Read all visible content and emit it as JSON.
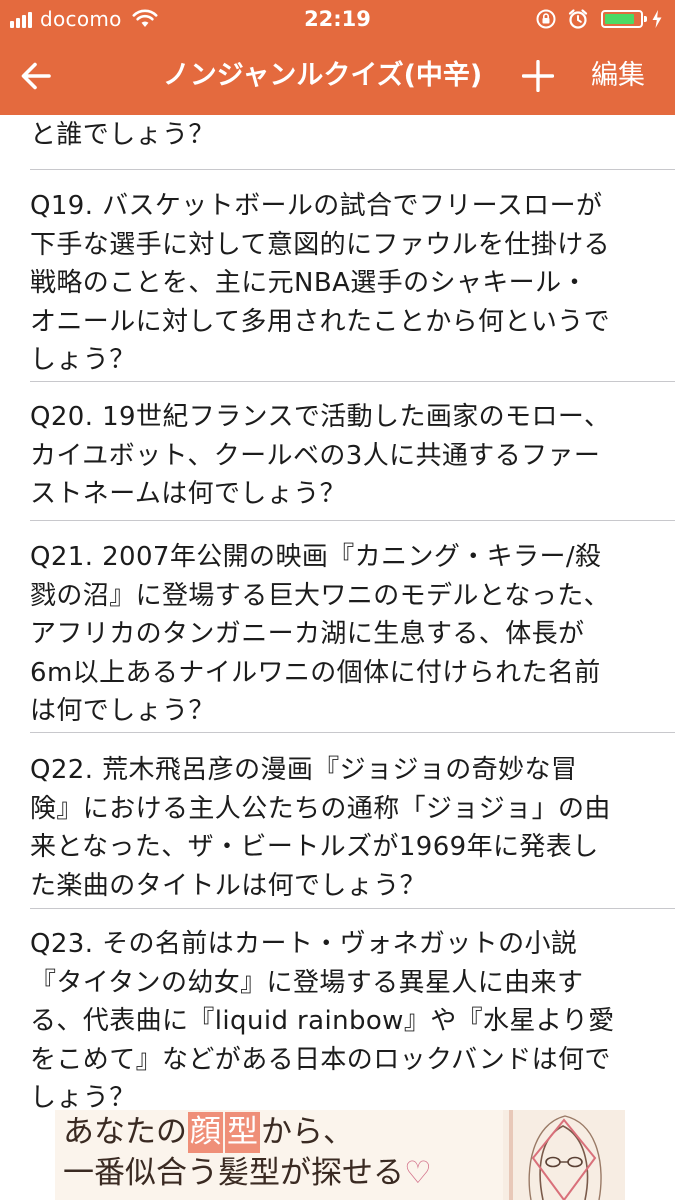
{
  "status_bar": {
    "carrier": "docomo",
    "time": "22:19"
  },
  "nav": {
    "title": "ノンジャンルクイズ(中辛)",
    "edit_label": "編集"
  },
  "colors": {
    "header_bg": "#e46a3e",
    "battery": "#4cd964"
  },
  "battery_level": 0.85,
  "questions": [
    {
      "lines": [
        "と誰でしょう？"
      ]
    },
    {
      "lines": [
        "Q19. バスケットボールの試合でフリースローが",
        "下手な選手に対して意図的にファウルを仕掛ける",
        "戦略のことを、主に元NBA選手のシャキール・",
        "オニールに対して多用されたことから何というで",
        "しょう？"
      ]
    },
    {
      "lines": [
        "Q20. 19世紀フランスで活動した画家のモロー、",
        "カイユボット、クールベの3人に共通するファー",
        "ストネームは何でしょう？"
      ]
    },
    {
      "lines": [
        "Q21. 2007年公開の映画『カニング・キラー/殺",
        "戮の沼』に登場する巨大ワニのモデルとなった、",
        "アフリカのタンガニーカ湖に生息する、体長が",
        "6m以上あるナイルワニの個体に付けられた名前",
        "は何でしょう？"
      ]
    },
    {
      "lines": [
        "Q22. 荒木飛呂彦の漫画『ジョジョの奇妙な冒",
        "険』における主人公たちの通称「ジョジョ」の由",
        "来となった、ザ・ビートルズが1969年に発表し",
        "た楽曲のタイトルは何でしょう？"
      ]
    },
    {
      "lines": [
        "Q23. その名前はカート・ヴォネガットの小説",
        "『タイタンの幼女』に登場する異星人に由来す",
        "る、代表曲に『liquid rainbow』や『水星より愛",
        "をこめて』などがある日本のロックバンドは何で",
        "しょう？"
      ]
    }
  ],
  "ad": {
    "line1_before": "あなたの",
    "line1_hl1": "顔",
    "line1_hl2": "型",
    "line1_after": "から、",
    "line2": "一番似合う髪型が探せる",
    "heart": "♡"
  },
  "icons": {
    "back": "arrow-left-icon",
    "add": "plus-icon",
    "wifi": "wifi-icon",
    "lock": "orientation-lock-icon",
    "alarm": "alarm-icon",
    "charging": "charging-bolt-icon"
  }
}
